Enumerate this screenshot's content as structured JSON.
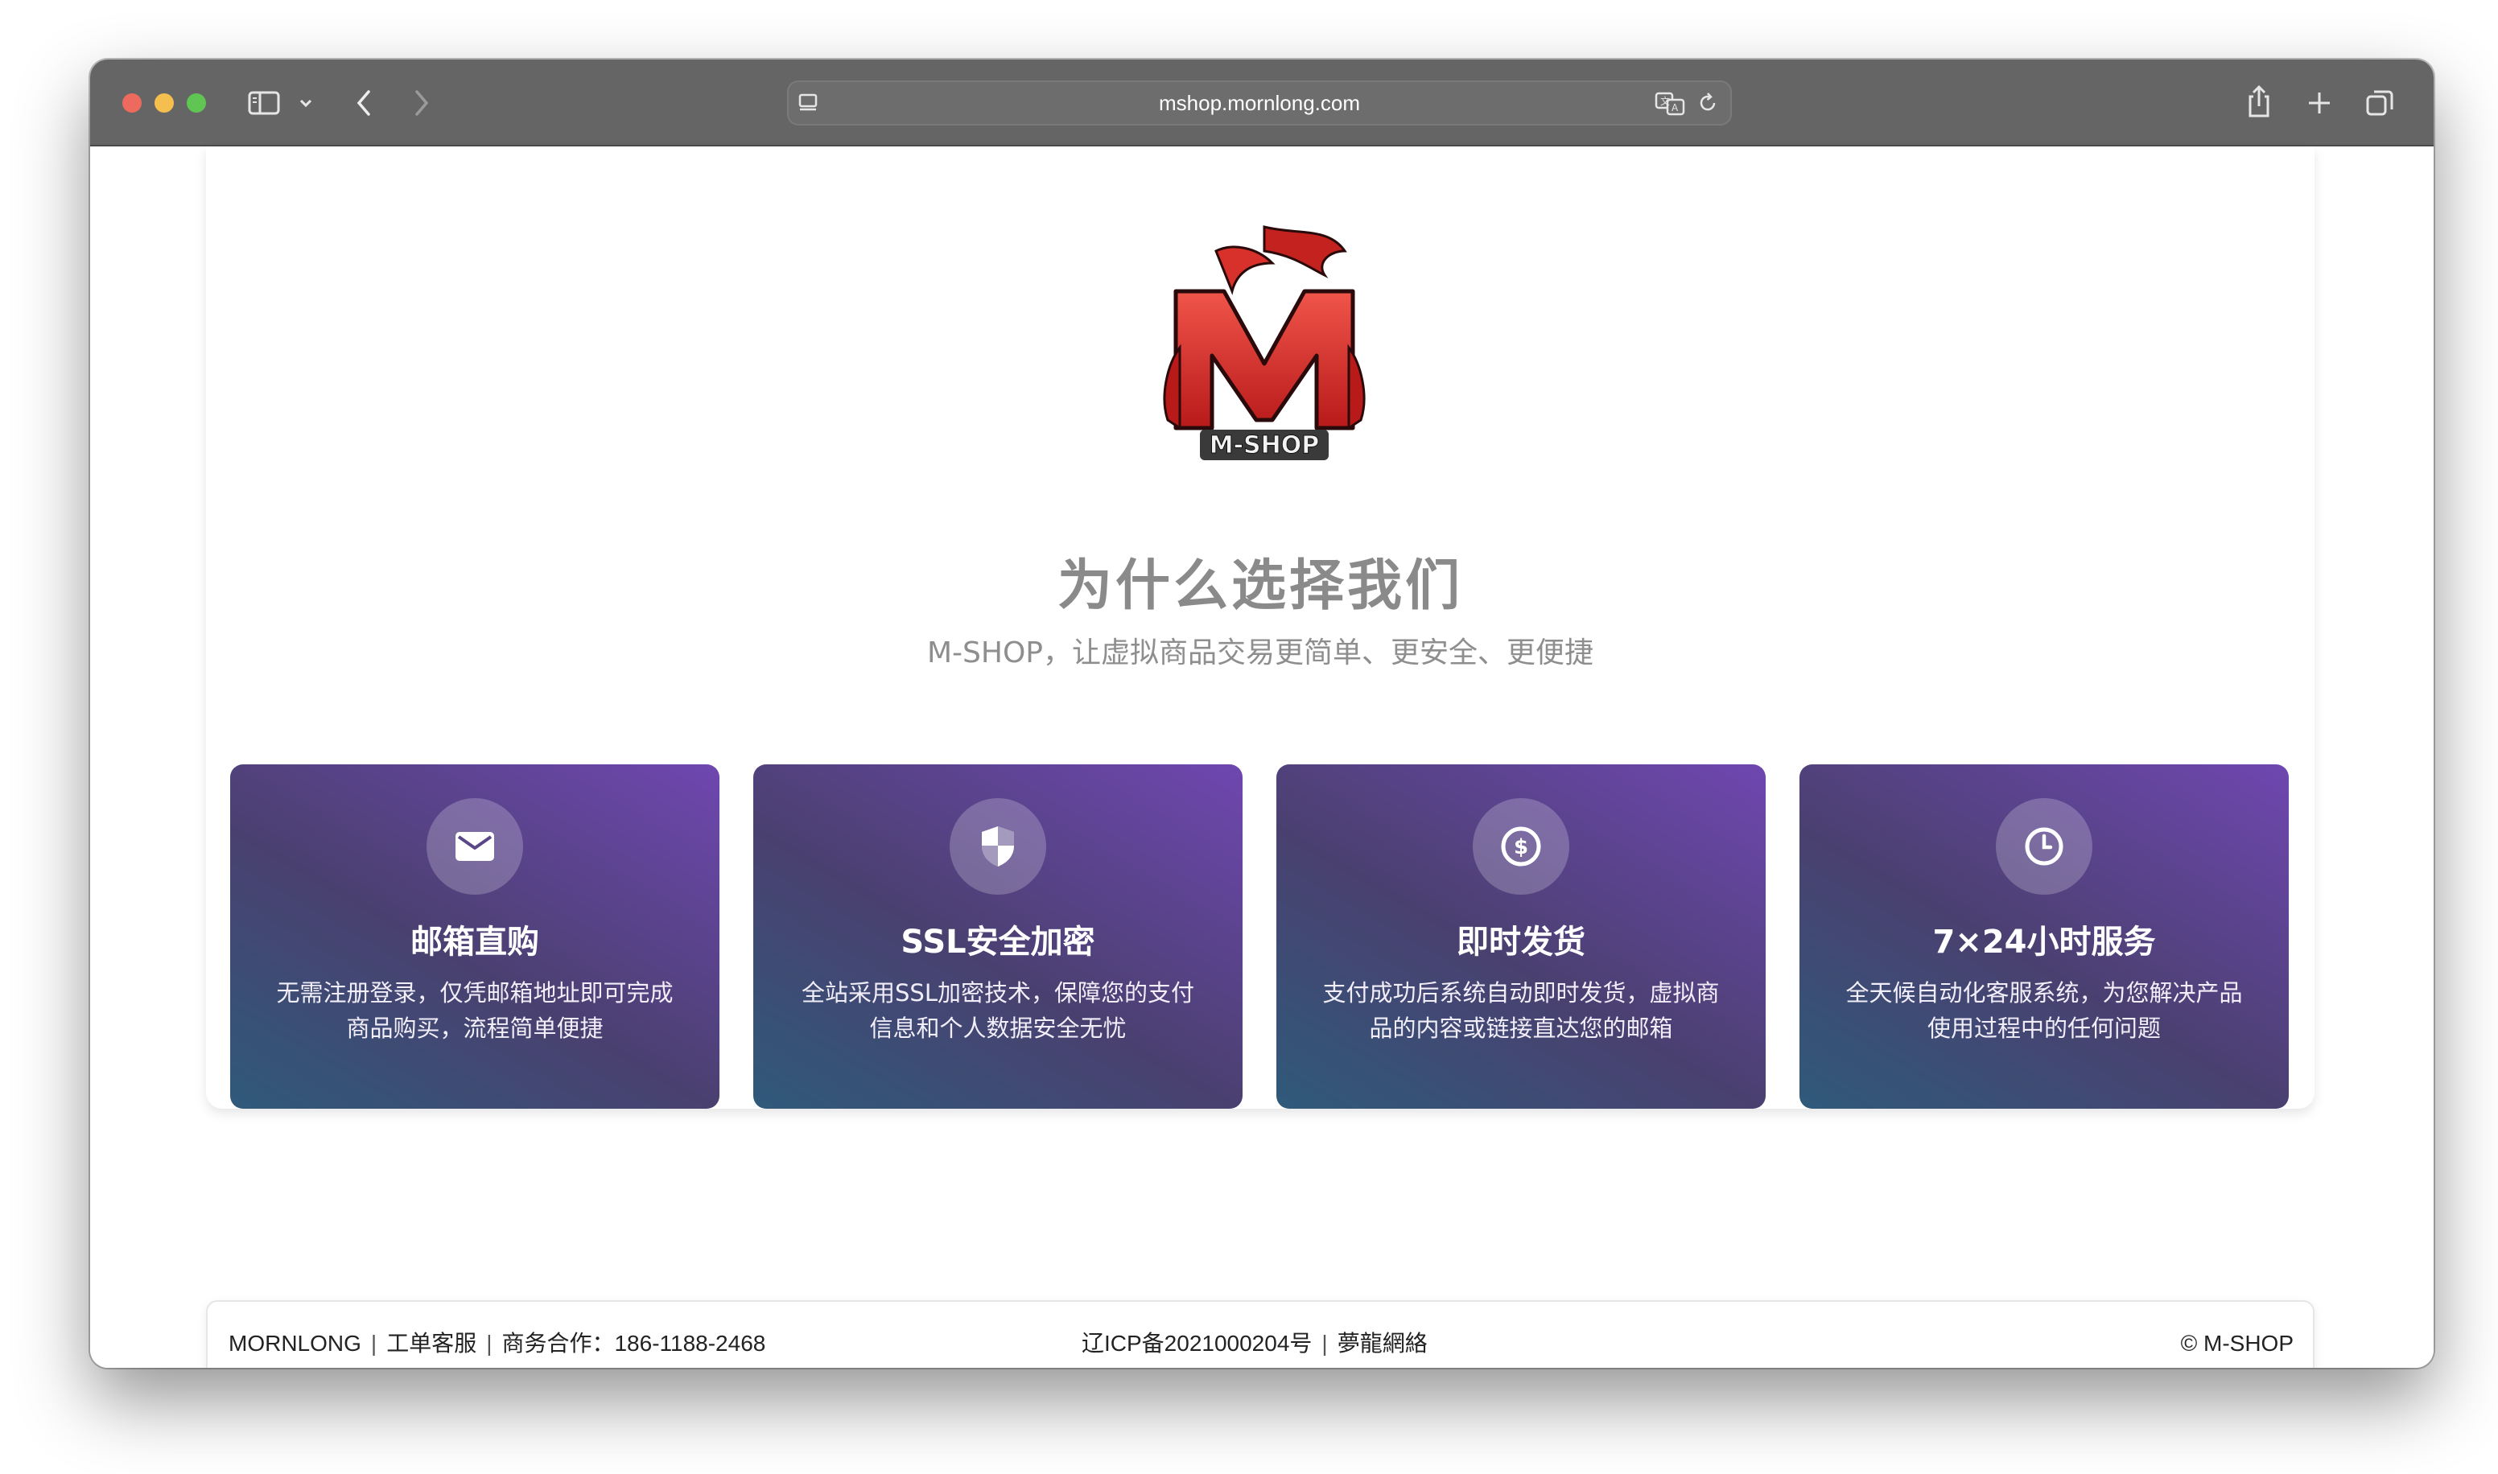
{
  "browser": {
    "url": "mshop.mornlong.com"
  },
  "logo": {
    "label": "M-SHOP"
  },
  "hero": {
    "title": "为什么选择我们",
    "subtitle": "M-SHOP，让虚拟商品交易更简单、更安全、更便捷"
  },
  "features": [
    {
      "icon": "mail-icon",
      "title": "邮箱直购",
      "line1": "无需注册登录，仅凭邮箱地址即可完成",
      "line2": "商品购买，流程简单便捷"
    },
    {
      "icon": "shield-icon",
      "title": "SSL安全加密",
      "line1": "全站采用SSL加密技术，保障您的支付",
      "line2": "信息和个人数据安全无忧"
    },
    {
      "icon": "dollar-icon",
      "title": "即时发货",
      "line1": "支付成功后系统自动即时发货，虚拟商",
      "line2": "品的内容或链接直达您的邮箱"
    },
    {
      "icon": "clock-icon",
      "title": "7×24小时服务",
      "line1": "全天候自动化客服系统，为您解决产品",
      "line2": "使用过程中的任何问题"
    }
  ],
  "footer": {
    "brand": "MORNLONG",
    "separator": "|",
    "ticket": "工单客服",
    "business": "商务合作：186-1188-2468",
    "icp": "辽ICP备2021000204号",
    "company": "夢龍網絡",
    "copyright": "© M-SHOP"
  },
  "colors": {
    "card_gradient_start": "#2f5a7a",
    "card_gradient_end": "#6f47b0",
    "titlebar": "#656565"
  }
}
